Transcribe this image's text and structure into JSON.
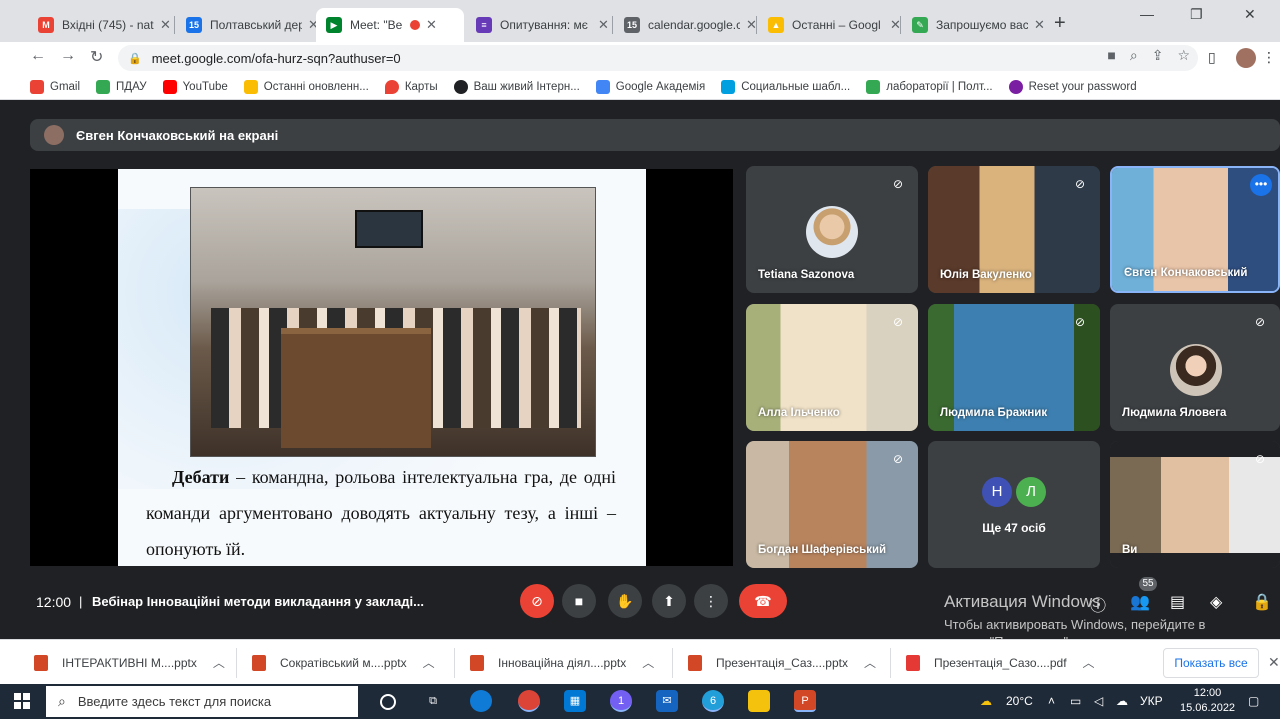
{
  "browser": {
    "tabs": [
      {
        "title": "Вхідні (745) - nat",
        "color": "#ea4335",
        "glyph": "M",
        "active": false
      },
      {
        "title": "Полтавський дер",
        "color": "#1a73e8",
        "glyph": "15",
        "active": false
      },
      {
        "title": "Meet: \"Вебін",
        "color": "#00832d",
        "glyph": "▶",
        "active": true
      },
      {
        "title": "Опитування: мє",
        "color": "#673ab7",
        "glyph": "≡",
        "active": false
      },
      {
        "title": "calendar.google.c",
        "color": "#5f6368",
        "glyph": "15",
        "active": false
      },
      {
        "title": "Останні – Googl",
        "color": "#fbbc04",
        "glyph": "▲",
        "active": false
      },
      {
        "title": "Запрошуємо вас",
        "color": "#34a853",
        "glyph": "✎",
        "active": false
      }
    ],
    "new_tab": "+",
    "url": "meet.google.com/ofa-hurz-sqn?authuser=0",
    "bookmarks": [
      {
        "label": "Gmail",
        "color": "#ea4335"
      },
      {
        "label": "ПДАУ",
        "color": "#34a853"
      },
      {
        "label": "YouTube",
        "color": "#ff0000"
      },
      {
        "label": "Останні оновленн...",
        "color": "#fbbc04"
      },
      {
        "label": "Карты",
        "color": "#ea4335"
      },
      {
        "label": "Ваш живий Інтерн...",
        "color": "#202124"
      },
      {
        "label": "Google Академія",
        "color": "#4285f4"
      },
      {
        "label": "Социальные шабл...",
        "color": "#00a0e0"
      },
      {
        "label": "лабораторії | Полт...",
        "color": "#34a853"
      },
      {
        "label": "Reset your password",
        "color": "#7b1fa2"
      }
    ]
  },
  "meet": {
    "presenting_banner": "Євген Кончаковський на екрані",
    "slide": {
      "term": "Дебати",
      "definition": " – командна, рольова інтелектуальна гра, де одні команди аргументовано доводять  актуальну тезу, а інші – опонують їй."
    },
    "participants": [
      {
        "name": "Tetiana Sazonova",
        "muted": true
      },
      {
        "name": "Юлія Вакуленко",
        "muted": true
      },
      {
        "name": "Євген Кончаковський",
        "muted": false,
        "active": true
      },
      {
        "name": "Алла Ільченко",
        "muted": true
      },
      {
        "name": "Людмила Бражник",
        "muted": true
      },
      {
        "name": "Людмила Яловега",
        "muted": true
      },
      {
        "name": "Богдан Шаферівський",
        "muted": true
      },
      {
        "name": "Ще 47 осіб",
        "initials": [
          "Н",
          "Л"
        ]
      },
      {
        "name": "Ви",
        "muted": true
      }
    ],
    "time": "12:00",
    "separator": "|",
    "meeting_title": "Вебінар Інноваційні методи викладання у закладі...",
    "participants_count": "55",
    "activation_title": "Активация Windows",
    "activation_text": "Чтобы активировать Windows, перейдите в раздел \"Параметры\"."
  },
  "downloads": {
    "items": [
      {
        "name": "ІНТЕРАКТИВНІ М....pptx",
        "color": "#d24726"
      },
      {
        "name": "Сократівський м....pptx",
        "color": "#d24726"
      },
      {
        "name": "Інноваційна діял....pptx",
        "color": "#d24726"
      },
      {
        "name": "Презентація_Саз....pptx",
        "color": "#d24726"
      },
      {
        "name": "Презентація_Сазо....pdf",
        "color": "#e53935"
      }
    ],
    "show_all": "Показать все"
  },
  "taskbar": {
    "search_placeholder": "Введите здесь текст для поиска",
    "weather": "20°C",
    "language": "УКР",
    "time": "12:00",
    "date": "15.06.2022",
    "telegram_badge": "6",
    "viber_badge": "1"
  }
}
